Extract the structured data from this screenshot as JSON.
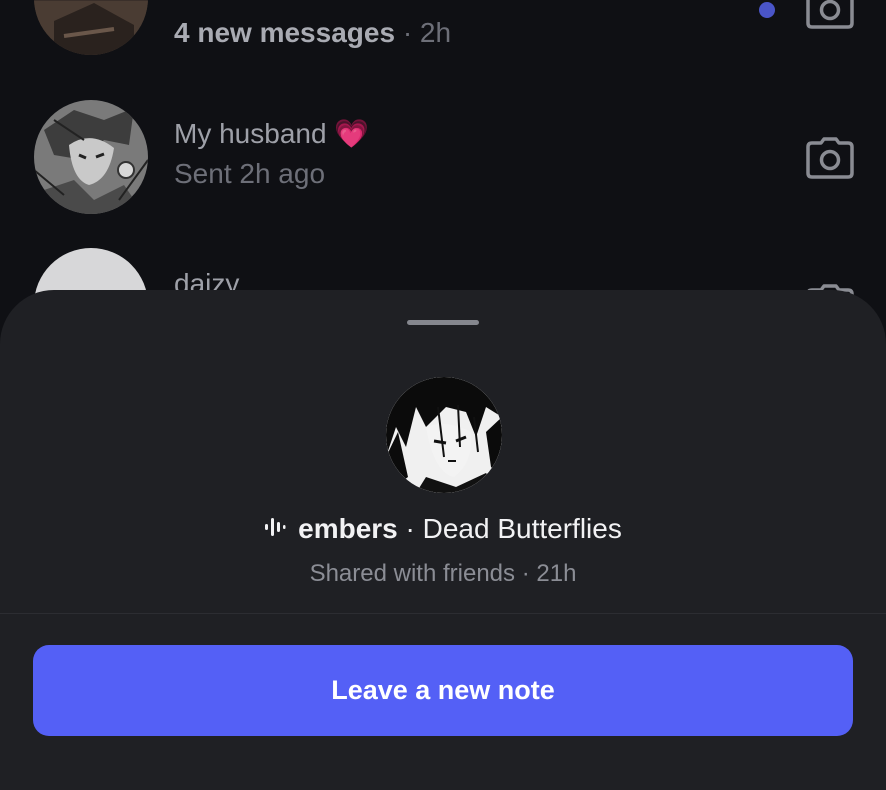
{
  "messages": [
    {
      "subtitle": "4 new messages",
      "separator": "·",
      "time": "2h",
      "unread": true,
      "action_icon": "camera-icon"
    },
    {
      "name": "My husband",
      "emoji": "💗",
      "subtitle": "Sent 2h ago",
      "unread": false,
      "action_icon": "camera-icon"
    },
    {
      "name": "daizy",
      "unread": false,
      "action_icon": "camera-icon"
    }
  ],
  "note_sheet": {
    "music_icon": "audio-bars-icon",
    "artist": "embers",
    "separator": "·",
    "song": "Dead Butterflies",
    "shared_label": "Shared with friends",
    "shared_separator": "·",
    "shared_time": "21h",
    "button_label": "Leave a new note"
  },
  "colors": {
    "background": "#0f1014",
    "sheet": "#1f2024",
    "accent": "#5460f6",
    "unread_dot": "#4a55c8"
  }
}
